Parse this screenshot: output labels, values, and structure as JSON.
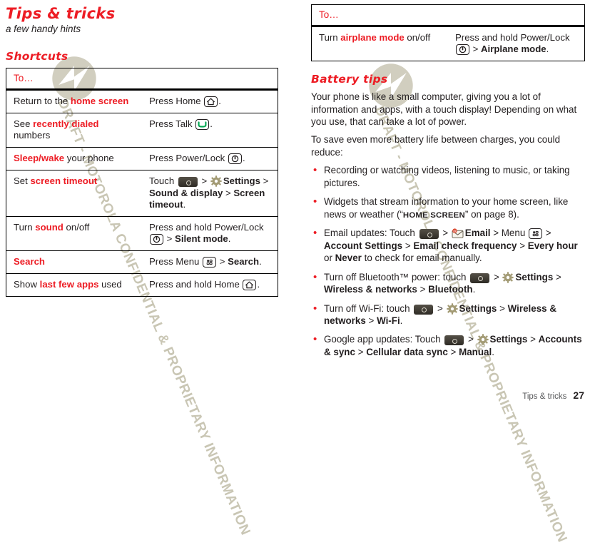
{
  "chapter": {
    "title": "Tips & tricks",
    "subtitle": "a few handy hints"
  },
  "sections": {
    "shortcuts_title": "Shortcuts",
    "battery_title": "Battery tips"
  },
  "shortcuts_table": {
    "header": "To…",
    "rows": [
      {
        "task_pre": "Return to the ",
        "task_hl": "home screen",
        "task_post": "",
        "action_pre": "Press Home ",
        "action_icon": "home-key-icon",
        "action_post": "."
      },
      {
        "task_pre": "See ",
        "task_hl": "recently dialed",
        "task_post": " numbers",
        "action_pre": "Press Talk ",
        "action_icon": "talk-key-icon",
        "action_post": "."
      },
      {
        "task_pre": "",
        "task_hl": "Sleep/wake",
        "task_post": " your phone",
        "action_pre": "Press Power/Lock ",
        "action_icon": "power-lock-key-icon",
        "action_post": "."
      },
      {
        "task_pre": "Set ",
        "task_hl": "screen timeout",
        "task_post": "",
        "action_pre": "Touch ",
        "action_icon": "launcher-icon",
        "action_post": " > ",
        "action_gear": "settings-gear-icon",
        "action_bold1": "Settings",
        "action_mid1": " > ",
        "action_bold2": "Sound & display",
        "action_mid2": " > ",
        "action_bold3": "Screen timeout",
        "action_end": "."
      },
      {
        "task_pre": "Turn ",
        "task_hl": "sound",
        "task_post": " on/off",
        "action_pre": "Press and hold Power/Lock ",
        "action_icon": "power-lock-key-icon",
        "action_post": " > ",
        "action_bold1": "Silent mode",
        "action_end": "."
      },
      {
        "task_pre": "",
        "task_hl": "Search",
        "task_post": "",
        "action_pre": "Press Menu ",
        "action_icon": "menu-key-icon",
        "action_post": " > ",
        "action_bold1": "Search",
        "action_end": "."
      },
      {
        "task_pre": "Show ",
        "task_hl": "last few apps",
        "task_post": " used",
        "action_pre": "Press and hold Home ",
        "action_icon": "home-key-icon",
        "action_post": "."
      }
    ]
  },
  "airplane_table": {
    "header": "To…",
    "rows": [
      {
        "task_pre": "Turn ",
        "task_hl": "airplane mode",
        "task_post": " on/off",
        "action_pre": "Press and hold Power/Lock ",
        "action_icon": "power-lock-key-icon",
        "action_post": " > ",
        "action_bold1": "Airplane mode",
        "action_end": "."
      }
    ]
  },
  "battery": {
    "intro1": "Your phone is like a small computer, giving you a lot of information and apps, with a touch display! Depending on what you use, that can take a lot of power.",
    "intro2": "To save even more battery life between charges, you could reduce:",
    "bullets": {
      "b1": "Recording or watching videos, listening to music, or taking pictures.",
      "b2_pre": "Widgets that stream information to your home screen, like news or weather (“",
      "b2_ref": "Home screen",
      "b2_post": "” on page 8).",
      "b3_pre": "Email updates: Touch ",
      "b3_gt1": " > ",
      "b3_bold_email": "Email",
      "b3_mid": " > Menu ",
      "b3_gt2": " > ",
      "b3_bold_account": "Account Settings",
      "b3_gt3": " > ",
      "b3_bold_freq": "Email check frequency",
      "b3_gt4": " > ",
      "b3_bold_every": "Every hour",
      "b3_or": " or ",
      "b3_bold_never": "Never",
      "b3_end": " to check for email manually.",
      "b4_pre": "Turn off Bluetooth™ power: touch ",
      "b4_gt1": " > ",
      "b4_bold_settings": "Settings",
      "b4_gt2": " > ",
      "b4_bold_wireless": "Wireless & networks",
      "b4_gt3": " > ",
      "b4_bold_bt": "Bluetooth",
      "b4_end": ".",
      "b5_pre": "Turn off Wi-Fi: touch ",
      "b5_gt1": " > ",
      "b5_bold_settings": "Settings",
      "b5_gt2": " > ",
      "b5_bold_wireless": "Wireless & networks",
      "b5_gt3": " > ",
      "b5_bold_wifi": "Wi-Fi",
      "b5_end": ".",
      "b6_pre": "Google app updates: Touch ",
      "b6_gt1": " > ",
      "b6_bold_settings": "Settings",
      "b6_gt2": " > ",
      "b6_bold_accounts": "Accounts & sync",
      "b6_gt3": " > ",
      "b6_bold_cell": "Cellular data sync",
      "b6_gt4": " > ",
      "b6_bold_manual": "Manual",
      "b6_end": "."
    }
  },
  "footer": {
    "chapter": "Tips & tricks",
    "page": "27"
  },
  "watermark": {
    "text": "DRAFT - MOTOROLA CONFIDENTIAL & PROPRIETARY INFORMATION"
  },
  "colors": {
    "accent_red": "#ed1c24",
    "text": "#231f20",
    "watermark": "#c9c6b4"
  }
}
